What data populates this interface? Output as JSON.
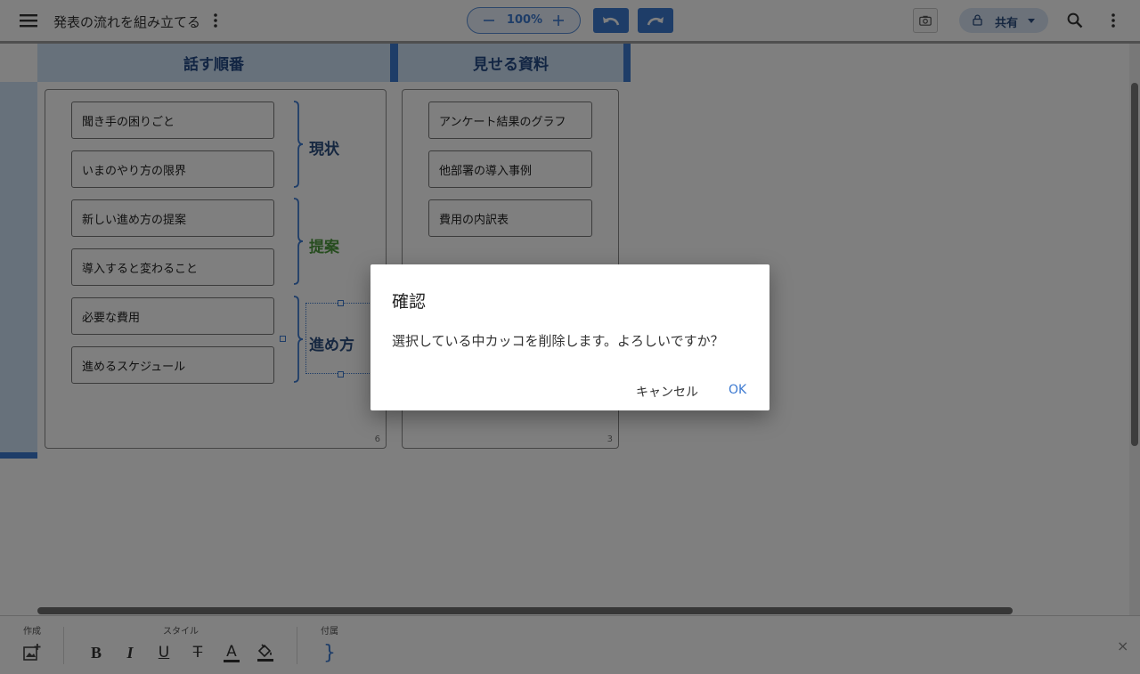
{
  "header": {
    "title": "発表の流れを組み立てる",
    "zoom": "100%",
    "share_label": "共有"
  },
  "columns": [
    {
      "heading": "話す順番",
      "count": "6"
    },
    {
      "heading": "見せる資料",
      "count": "3"
    }
  ],
  "order_cards": [
    "聞き手の困りごと",
    "いまのやり方の限界",
    "新しい進め方の提案",
    "導入すると変わること",
    "必要な費用",
    "進めるスケジュール"
  ],
  "brace_labels": [
    {
      "text": "現状",
      "color": "#2c4f80"
    },
    {
      "text": "提案",
      "color": "#4e9a3f"
    },
    {
      "text": "進め方",
      "color": "#2c4f80"
    }
  ],
  "material_cards": [
    "アンケート結果のグラフ",
    "他部署の導入事例",
    "費用の内訳表"
  ],
  "toolbar": {
    "create_label": "作成",
    "style_label": "スタイル",
    "attach_label": "付属",
    "bold": "B",
    "italic": "I",
    "underline": "U",
    "strike": "T",
    "font_color": "A",
    "brace_glyph": "}",
    "close": "×"
  },
  "dialog": {
    "title": "確認",
    "message": "選択している中カッコを削除します。よろしいですか？",
    "cancel_label": "キャンセル",
    "ok_label": "OK"
  },
  "colors": {
    "accent": "#3d7ad1",
    "header_band": "#cfe2f7",
    "brace": "#3d7ad1"
  }
}
